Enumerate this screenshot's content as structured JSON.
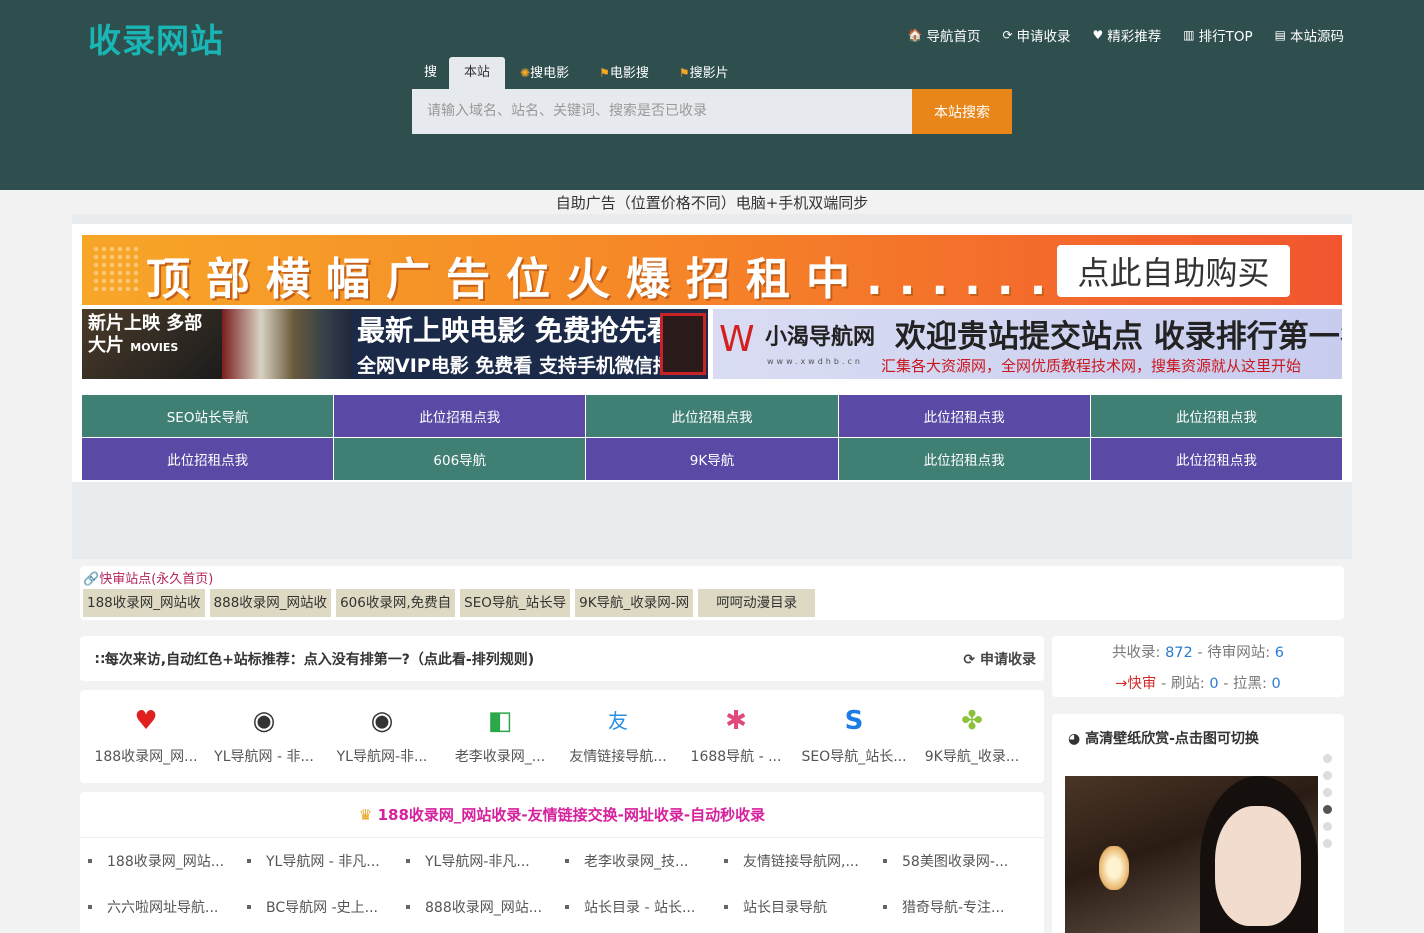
{
  "logo": "收录网站",
  "topnav": [
    {
      "icon": "home-icon",
      "glyph": "🏠",
      "label": "导航首页"
    },
    {
      "icon": "refresh-icon",
      "glyph": "⟳",
      "label": "申请收录"
    },
    {
      "icon": "heart-icon",
      "glyph": "♥",
      "label": "精彩推荐"
    },
    {
      "icon": "bar-chart-icon",
      "glyph": "▥",
      "label": "排行TOP"
    },
    {
      "icon": "code-icon",
      "glyph": "▤",
      "label": "本站源码"
    }
  ],
  "search": {
    "label": "搜",
    "tabs": [
      {
        "label": "本站",
        "active": true
      },
      {
        "label": "搜电影",
        "active": false
      },
      {
        "label": "电影搜",
        "active": false
      },
      {
        "label": "搜影片",
        "active": false
      }
    ],
    "placeholder": "请输入域名、站名、关键词、搜索是否已收录",
    "button": "本站搜索"
  },
  "ad_note": "自助广告（位置价格不同）电脑+手机双端同步",
  "banners": {
    "top_text": "顶部横幅广告位火爆招租中......",
    "top_button": "点此自助购买",
    "left_badge": "新片上映 多部大片",
    "left_badge_en": "MOVIES",
    "left_line1": "最新上映电影 免费抢先看",
    "left_line2": "全网VIP电影 免费看 支持手机微信播放",
    "right_logo": "小渴导航网",
    "right_logo_sub": "www.xwdhb.cn",
    "right_line1": "欢迎贵站提交站点 收录排行第一名",
    "right_line2": "汇集各大资源网，全网优质教程技术网，搜集资源就从这里开始"
  },
  "ad_grid": [
    {
      "label": "SEO站长导航",
      "color": "g"
    },
    {
      "label": "此位招租点我",
      "color": "p"
    },
    {
      "label": "此位招租点我",
      "color": "g"
    },
    {
      "label": "此位招租点我",
      "color": "p"
    },
    {
      "label": "此位招租点我",
      "color": "g"
    },
    {
      "label": "此位招租点我",
      "color": "p"
    },
    {
      "label": "606导航",
      "color": "g"
    },
    {
      "label": "9K导航",
      "color": "p"
    },
    {
      "label": "此位招租点我",
      "color": "g"
    },
    {
      "label": "此位招租点我",
      "color": "p"
    }
  ],
  "quick": {
    "title": "快审站点(永久首页)",
    "tags": [
      "188收录网_网站收",
      "888收录网_网站收",
      "606收录网,免费自",
      "SEO导航_站长导",
      "9K导航_收录网-网",
      "呵呵动漫目录"
    ]
  },
  "notice": {
    "text": "每次来访,自动红色+站标推荐：点入没有排第一?（点此看-排列规则)",
    "apply": "申请收录"
  },
  "icon_sites": [
    {
      "icon": "heart-icon",
      "glyph": "♥",
      "color": "#e0201e",
      "name": "188收录网_网..."
    },
    {
      "icon": "globe-icon",
      "glyph": "◉",
      "color": "#333333",
      "name": "YL导航网 - 非..."
    },
    {
      "icon": "globe-icon",
      "glyph": "◉",
      "color": "#333333",
      "name": "YL导航网-非..."
    },
    {
      "icon": "leaf-icon",
      "glyph": "◧",
      "color": "#2aa84a",
      "name": "老李收录网_..."
    },
    {
      "icon": "friend-icon",
      "glyph": "友",
      "color": "#2a8fe0",
      "name": "友情链接导航..."
    },
    {
      "icon": "pinwheel-icon",
      "glyph": "✱",
      "color": "#e04a7a",
      "name": "1688导航 - ..."
    },
    {
      "icon": "s-logo-icon",
      "glyph": "S",
      "color": "#1e7ce6",
      "name": "SEO导航_站长..."
    },
    {
      "icon": "clover-icon",
      "glyph": "✤",
      "color": "#8bc23a",
      "name": "9K导航_收录..."
    }
  ],
  "list": {
    "title": "188收录网_网站收录-友情链接交换-网址收录-自动秒收录",
    "row1": [
      "188收录网_网站...",
      "YL导航网 - 非凡...",
      "YL导航网-非凡...",
      "老李收录网_技...",
      "友情链接导航网,...",
      "58美图收录网-..."
    ],
    "row2": [
      "六六啦网址导航...",
      "BC导航网 -史上...",
      "888收录网_网站...",
      "站长目录 - 站长...",
      "站长目录导航",
      "猎奇导航-专注..."
    ]
  },
  "stats": {
    "total_label": "共收录:",
    "total": "872",
    "pending_label": "- 待审网站:",
    "pending": "6",
    "fast": "→快审",
    "brush_label": "- 刷站:",
    "brush": "0",
    "black_label": "- 拉黑:",
    "black": "0"
  },
  "wallpaper": {
    "title": "高清壁纸欣赏-点击图可切换"
  }
}
